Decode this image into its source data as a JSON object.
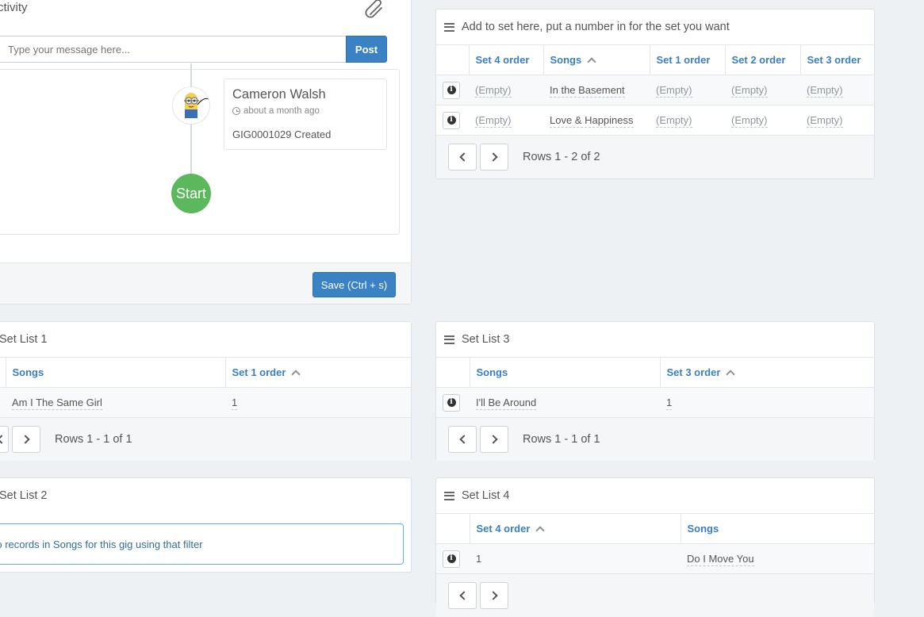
{
  "activity": {
    "title": "Activity",
    "attach_icon": "paperclip-icon",
    "message_placeholder": "Type your message here...",
    "post_label": "Post",
    "entry": {
      "author": "Cameron Walsh",
      "time": "about a month ago",
      "text": "GIG0001029 Created",
      "clock_icon": "clock-icon"
    },
    "start_label": "Start",
    "save_label": "Save (Ctrl + s)"
  },
  "add_to_set": {
    "title": "Add to set here, put a number in for the set you want",
    "columns": [
      "Set 4 order",
      "Songs",
      "Set 1 order",
      "Set 2 order",
      "Set 3 order"
    ],
    "rows": [
      [
        "(Empty)",
        "In the Basement",
        "(Empty)",
        "(Empty)",
        "(Empty)"
      ],
      [
        "(Empty)",
        "Love & Happiness",
        "(Empty)",
        "(Empty)",
        "(Empty)"
      ]
    ],
    "pager_text": "Rows 1 - 2 of 2"
  },
  "set_list_1": {
    "title": "Set List 1",
    "columns": [
      "Songs",
      "Set 1 order"
    ],
    "rows": [
      [
        "Am I The Same Girl",
        "1"
      ]
    ],
    "pager_text": "Rows 1 - 1 of 1"
  },
  "set_list_2": {
    "title": "Set List 2",
    "notice": "No records in Songs for this gig using that filter"
  },
  "set_list_3": {
    "title": "Set List 3",
    "columns": [
      "Songs",
      "Set 3 order"
    ],
    "rows": [
      [
        "I'll Be Around",
        "1"
      ]
    ],
    "pager_text": "Rows 1 - 1 of 1"
  },
  "set_list_4": {
    "title": "Set List 4",
    "columns": [
      "Set 4 order",
      "Songs"
    ],
    "rows": [
      [
        "1",
        "Do I Move You"
      ]
    ]
  },
  "colors": {
    "accent": "#3a82c4",
    "start": "#5cb85c",
    "background": "#eef1f4"
  }
}
